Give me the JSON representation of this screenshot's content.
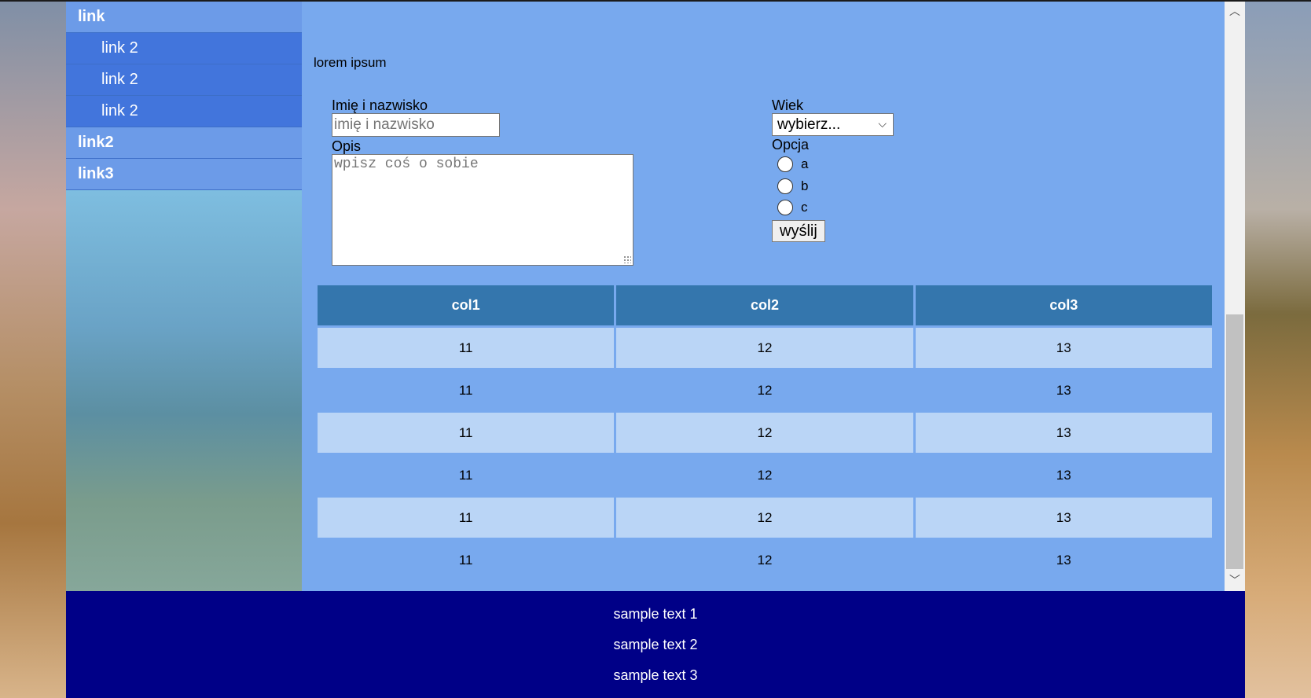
{
  "sidebar": {
    "items": [
      {
        "label": "link"
      },
      {
        "label": "link 2"
      },
      {
        "label": "link 2"
      },
      {
        "label": "link 2"
      },
      {
        "label": "link2"
      },
      {
        "label": "link3"
      }
    ]
  },
  "main": {
    "intro": "lorem ipsum",
    "form": {
      "name_label": "Imię i nazwisko",
      "name_placeholder": "imię i nazwisko",
      "desc_label": "Opis",
      "desc_placeholder": "wpisz coś o sobie",
      "age_label": "Wiek",
      "age_selected": "wybierz...",
      "option_label": "Opcja",
      "options": [
        "a",
        "b",
        "c"
      ],
      "submit_label": "wyślij"
    },
    "table": {
      "headers": [
        "col1",
        "col2",
        "col3"
      ],
      "rows": [
        [
          "11",
          "12",
          "13"
        ],
        [
          "11",
          "12",
          "13"
        ],
        [
          "11",
          "12",
          "13"
        ],
        [
          "11",
          "12",
          "13"
        ],
        [
          "11",
          "12",
          "13"
        ],
        [
          "11",
          "12",
          "13"
        ]
      ]
    }
  },
  "footer": {
    "lines": [
      "sample text 1",
      "sample text 2",
      "sample text 3"
    ]
  },
  "colors": {
    "main_bg": "#78a9ee",
    "menu_top": "#6c9be8",
    "menu_sub": "#4275dc",
    "table_header": "#3476ad",
    "table_row_alt": "#bad5f6",
    "footer_bg": "#000087"
  },
  "icons": {
    "scroll_up": "chevron-up-icon",
    "scroll_down": "chevron-down-icon",
    "select_arrow": "chevron-down-icon"
  }
}
